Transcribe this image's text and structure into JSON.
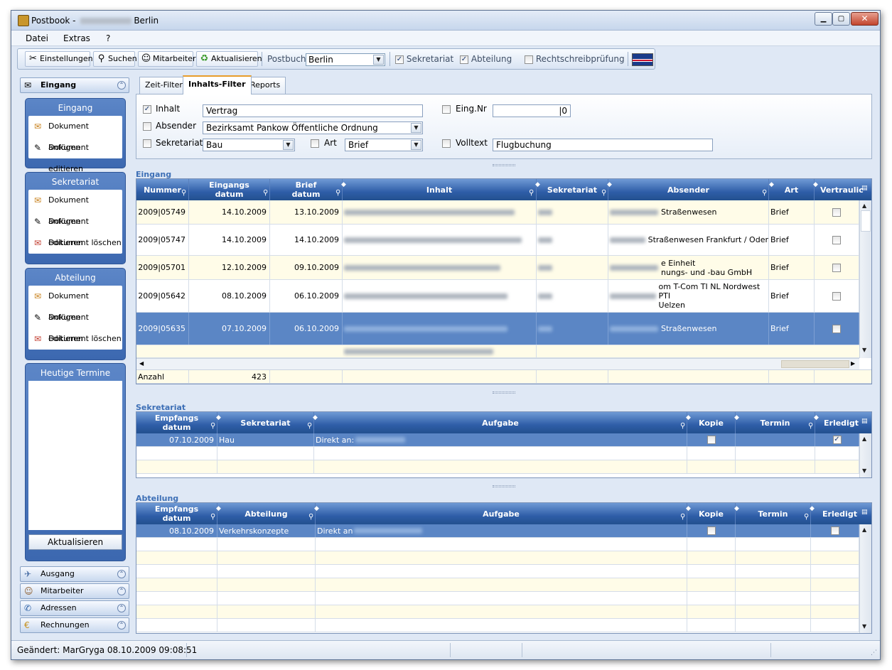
{
  "window": {
    "title_prefix": "Postbook - ",
    "title_suffix": "Berlin",
    "min": "▁",
    "max": "▢",
    "close": "✕"
  },
  "menu": [
    "Datei",
    "Extras",
    "?"
  ],
  "toolbar": {
    "buttons": [
      {
        "label": "Einstellungen",
        "icon": "tools-icon"
      },
      {
        "label": "Suchen",
        "icon": "search-icon"
      },
      {
        "label": "Mitarbeiter",
        "icon": "users-icon"
      },
      {
        "label": "Aktualisieren",
        "icon": "refresh-icon"
      }
    ],
    "postbook_label": "Postbuch",
    "postbook_value": "Berlin",
    "checks": [
      {
        "label": "Sekretariat",
        "checked": true
      },
      {
        "label": "Abteilung",
        "checked": true
      },
      {
        "label": "Rechtschreibprüfung",
        "checked": false
      }
    ]
  },
  "left": {
    "eingang_header": "Eingang",
    "groups": [
      {
        "title": "Eingang",
        "items": [
          "Dokument anfügen",
          "Dokument editieren"
        ]
      },
      {
        "title": "Sekretariat",
        "items": [
          "Dokument anfügen",
          "Dokument editieren",
          "Dokument löschen"
        ]
      },
      {
        "title": "Abteilung",
        "items": [
          "Dokument anfügen",
          "Dokument editieren",
          "Dokument löschen"
        ]
      }
    ],
    "termine_title": "Heutige Termine",
    "termine_button": "Aktualisieren",
    "bottom": [
      "Ausgang",
      "Mitarbeiter",
      "Adressen",
      "Rechnungen"
    ]
  },
  "tabs": [
    "Zeit-Filter",
    "Inhalts-Filter",
    "Reports"
  ],
  "filter": {
    "inhalt_label": "Inhalt",
    "inhalt_value": "Vertrag",
    "inhalt_checked": true,
    "absender_label": "Absender",
    "absender_value": "Bezirksamt Pankow Öffentliche Ordnung",
    "sekretariat_label": "Sekretariat",
    "sekretariat_value": "Bau",
    "art_label": "Art",
    "art_value": "Brief",
    "eingnr_label": "Eing.Nr",
    "eingnr_value": "|0",
    "volltext_label": "Volltext",
    "volltext_value": "Flugbuchung"
  },
  "eingang": {
    "section": "Eingang",
    "headers": [
      "Nummer",
      "Eingangs datum",
      "Brief datum",
      "Inhalt",
      "Sekretariat",
      "Absender",
      "Art",
      "Vertraulic"
    ],
    "rows": [
      {
        "nummer": "2009|05749",
        "eingang": "14.10.2009",
        "brief": "13.10.2009",
        "absender": "Straßenwesen",
        "art": "Brief",
        "sel": false
      },
      {
        "nummer": "2009|05747",
        "eingang": "14.10.2009",
        "brief": "14.10.2009",
        "absender": "Straßenwesen Frankfurt / Oder",
        "art": "Brief",
        "sel": false
      },
      {
        "nummer": "2009|05701",
        "eingang": "12.10.2009",
        "brief": "09.10.2009",
        "absender": "e Einheit\nnungs- und -bau GmbH",
        "art": "Brief",
        "sel": false
      },
      {
        "nummer": "2009|05642",
        "eingang": "08.10.2009",
        "brief": "06.10.2009",
        "absender": "om T-Com TI NL Nordwest PTI\nUelzen",
        "art": "Brief",
        "sel": false
      },
      {
        "nummer": "2009|05635",
        "eingang": "07.10.2009",
        "brief": "06.10.2009",
        "absender": "Straßenwesen",
        "art": "Brief",
        "sel": true
      }
    ],
    "anzahl_label": "Anzahl",
    "anzahl_value": "423"
  },
  "sekretariat": {
    "section": "Sekretariat",
    "headers": [
      "Empfangs datum",
      "Sekretariat",
      "Aufgabe",
      "Kopie",
      "Termin",
      "Erledigt"
    ],
    "row": {
      "datum": "07.10.2009",
      "sekretariat": "Hau",
      "aufgabe": "Direkt an:",
      "kopie": false,
      "erledigt": true
    }
  },
  "abteilung": {
    "section": "Abteilung",
    "headers": [
      "Empfangs datum",
      "Abteilung",
      "Aufgabe",
      "Kopie",
      "Termin",
      "Erledigt"
    ],
    "row": {
      "datum": "08.10.2009",
      "abteilung": "Verkehrskonzepte",
      "aufgabe": "Direkt an",
      "kopie": false,
      "erledigt": false
    }
  },
  "status": {
    "text": "Geändert: MarGryga 08.10.2009 09:08:51"
  }
}
